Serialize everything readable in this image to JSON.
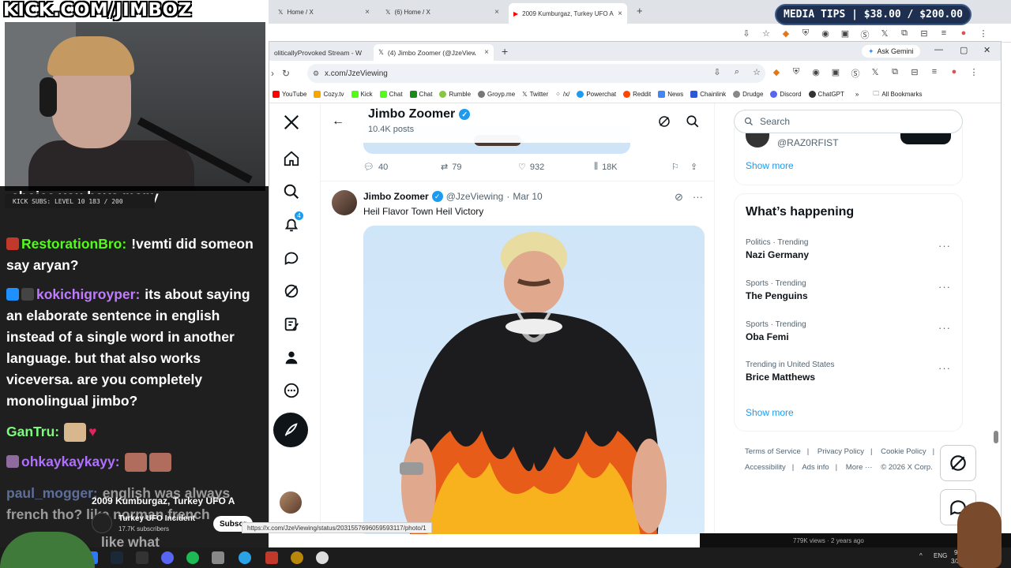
{
  "overlay": {
    "site_title": "KICK.COM/JIMBOZ",
    "media_tips": "MEDIA TIPS | $38.00 / $200.00",
    "kick_subs": "KICK SUBS: LEVEL 10 183 / 200"
  },
  "back_browser": {
    "tabs": [
      "Home / X",
      "(6) Home / X",
      "2009 Kumburgaz, Turkey UFO A"
    ]
  },
  "browser": {
    "tabs": [
      "oliticallyProvoked Stream - W",
      "(4) Jimbo Zoomer (@JzeViewing"
    ],
    "ask_gemini": "Ask Gemini",
    "url": "x.com/JzeViewing",
    "bookmarks": [
      "YouTube",
      "Cozy.tv",
      "Kick",
      "Chat",
      "Chat",
      "Rumble",
      "Groyp.me",
      "Twitter",
      "/x/",
      "Powerchat",
      "Reddit",
      "News",
      "Chainlink",
      "Drudge",
      "Discord",
      "ChatGPT"
    ],
    "all_bookmarks": "All Bookmarks",
    "status_url": "https://x.com/JzeViewing/status/2031557696059593117/photo/1"
  },
  "x_page": {
    "header": {
      "name": "Jimbo Zoomer",
      "post_count": "10.4K posts"
    },
    "notification_count": "4",
    "prev_actions": {
      "replies": "40",
      "reposts": "79",
      "likes": "932",
      "views": "18K"
    },
    "tweet": {
      "name": "Jimbo Zoomer",
      "handle": "@JzeViewing",
      "sep": "·",
      "date": "Mar 10",
      "text": "Heil Flavor Town Heil Victory"
    },
    "sidebar": {
      "search_placeholder": "Search",
      "wtf_handle": "@RAZ0RFIST",
      "show_more": "Show more",
      "trending_title": "What’s happening",
      "trends": [
        {
          "category": "Politics · Trending",
          "name": "Nazi Germany"
        },
        {
          "category": "Sports · Trending",
          "name": "The Penguins"
        },
        {
          "category": "Sports · Trending",
          "name": "Oba Femi"
        },
        {
          "category": "Trending in United States",
          "name": "Brice Matthews"
        }
      ],
      "trends_show_more": "Show more",
      "footer": [
        "Terms of Service",
        "|",
        "Privacy Policy",
        "|",
        "Cookie Policy",
        "|",
        "Accessibility",
        "|",
        "Ads info",
        "|",
        "More ···",
        "© 2026 X Corp."
      ]
    }
  },
  "chat": [
    {
      "user": "",
      "user_color": "#ffffff",
      "message": "choice you have many"
    },
    {
      "user": "RestorationBro:",
      "user_color": "#53fc18",
      "message": "!vemti did someon say aryan?"
    },
    {
      "user": "kokichigroyper:",
      "user_color": "#c07cff",
      "message": "its about saying an elaborate sentence in english instead of a single word in another language. but that also works viceversa. are you completely monolingual jimbo?"
    },
    {
      "user": "GanTru:",
      "user_color": "#7cfc7c",
      "message": ""
    },
    {
      "user": "ohkaykaykayy:",
      "user_color": "#b070ff",
      "message": ""
    },
    {
      "user": "paul_mogger:",
      "user_color": "#8fb0ff",
      "message": "english was always french tho? like norman french"
    },
    {
      "user": "",
      "user_color": "#ffffff",
      "message": "like what"
    }
  ],
  "youtube": {
    "title": "2009 Kumburgaz, Turkey UFO A",
    "channel": "Turkey UFO Incident",
    "subscribers": "17.7K subscribers",
    "subscribe": "Subscr",
    "views": "779K views · 2 years ago"
  },
  "taskbar": {
    "lang": "ENG",
    "time": "9:",
    "date": "3/30"
  },
  "colors": {
    "x_blue": "#1d9bf0",
    "x_text": "#0f1419",
    "x_muted": "#536471",
    "kick_green": "#53fc18"
  }
}
